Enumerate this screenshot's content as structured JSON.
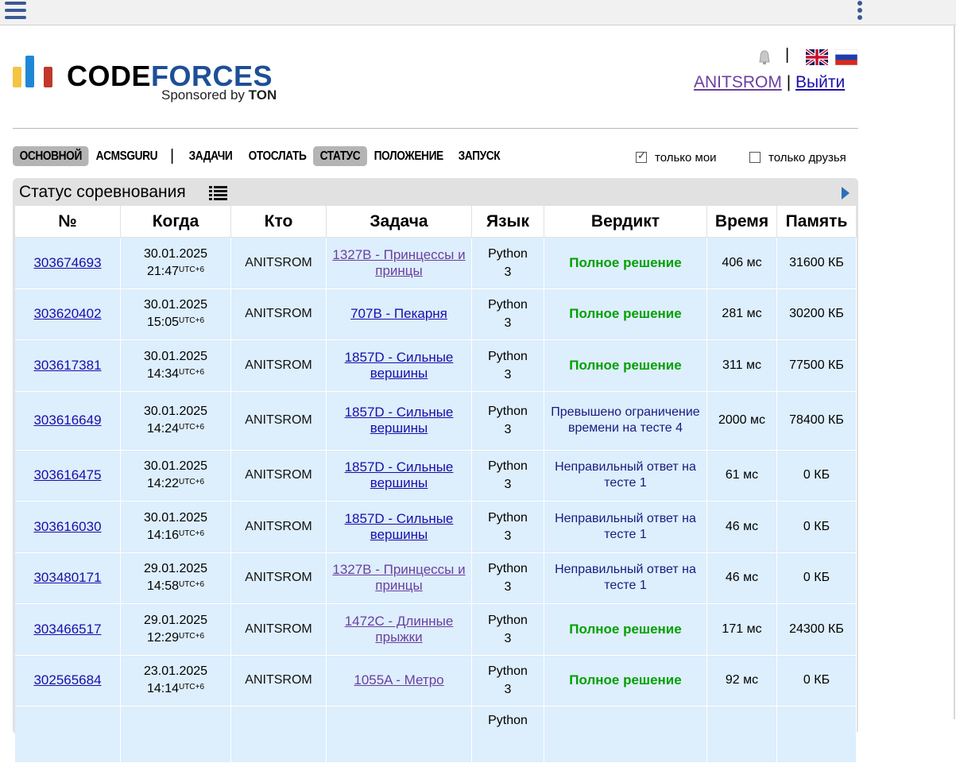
{
  "header": {
    "logo_code": "CODE",
    "logo_forces": "FORCES",
    "sponsor_prefix": "Sponsored by",
    "sponsor_brand": "TON",
    "separator": "|",
    "username": "ANITSROM",
    "user_separator": "|",
    "logout": "Выйти",
    "icons": [
      "menu-icon",
      "more-vert-icon",
      "bell-icon",
      "flag-uk-icon",
      "flag-ru-icon"
    ]
  },
  "menu": {
    "items": [
      {
        "label": "ОСНОВНОЙ",
        "active": true
      },
      {
        "label": "ACMSGURU",
        "active": false
      },
      {
        "label": "ЗАДАЧИ",
        "active": false
      },
      {
        "label": "ОТОСЛАТЬ",
        "active": false
      },
      {
        "label": "СТАТУС",
        "active": true
      },
      {
        "label": "ПОЛОЖЕНИЕ",
        "active": false
      },
      {
        "label": "ЗАПУСК",
        "active": false
      }
    ],
    "separator": "|",
    "filters": {
      "only_mine": {
        "label": "только мои",
        "checked": true
      },
      "only_friends": {
        "label": "только друзья",
        "checked": false
      }
    }
  },
  "status": {
    "title": "Статус соревнования",
    "columns": [
      "№",
      "Когда",
      "Кто",
      "Задача",
      "Язык",
      "Вердикт",
      "Время",
      "Память"
    ],
    "rows": [
      {
        "id": "303674693",
        "date": "30.01.2025",
        "time": "21:47",
        "tz": "UTC+6",
        "who": "ANITSROM",
        "problem": "1327B - Принцессы и принцы",
        "lang_1": "Python",
        "lang_2": "3",
        "verdict": "Полное решение",
        "ok": true,
        "run_time": "406 мс",
        "memory": "31600 КБ"
      },
      {
        "id": "303620402",
        "date": "30.01.2025",
        "time": "15:05",
        "tz": "UTC+6",
        "who": "ANITSROM",
        "problem": "707B - Пекарня",
        "lang_1": "Python",
        "lang_2": "3",
        "verdict": "Полное решение",
        "ok": true,
        "run_time": "281 мс",
        "memory": "30200 КБ"
      },
      {
        "id": "303617381",
        "date": "30.01.2025",
        "time": "14:34",
        "tz": "UTC+6",
        "who": "ANITSROM",
        "problem": "1857D - Сильные вершины",
        "lang_1": "Python",
        "lang_2": "3",
        "verdict": "Полное решение",
        "ok": true,
        "run_time": "311 мс",
        "memory": "77500 КБ"
      },
      {
        "id": "303616649",
        "date": "30.01.2025",
        "time": "14:24",
        "tz": "UTC+6",
        "who": "ANITSROM",
        "problem": "1857D - Сильные вершины",
        "lang_1": "Python",
        "lang_2": "3",
        "verdict": "Превышено ограничение времени на тесте 4",
        "ok": false,
        "run_time": "2000 мс",
        "memory": "78400 КБ"
      },
      {
        "id": "303616475",
        "date": "30.01.2025",
        "time": "14:22",
        "tz": "UTC+6",
        "who": "ANITSROM",
        "problem": "1857D - Сильные вершины",
        "lang_1": "Python",
        "lang_2": "3",
        "verdict": "Неправильный ответ на тесте 1",
        "ok": false,
        "run_time": "61 мс",
        "memory": "0 КБ"
      },
      {
        "id": "303616030",
        "date": "30.01.2025",
        "time": "14:16",
        "tz": "UTC+6",
        "who": "ANITSROM",
        "problem": "1857D - Сильные вершины",
        "lang_1": "Python",
        "lang_2": "3",
        "verdict": "Неправильный ответ на тесте 1",
        "ok": false,
        "run_time": "46 мс",
        "memory": "0 КБ"
      },
      {
        "id": "303480171",
        "date": "29.01.2025",
        "time": "14:58",
        "tz": "UTC+6",
        "who": "ANITSROM",
        "problem": "1327B - Принцессы и принцы",
        "lang_1": "Python",
        "lang_2": "3",
        "verdict": "Неправильный ответ на тесте 1",
        "ok": false,
        "run_time": "46 мс",
        "memory": "0 КБ"
      },
      {
        "id": "303466517",
        "date": "29.01.2025",
        "time": "12:29",
        "tz": "UTC+6",
        "who": "ANITSROM",
        "problem": "1472C - Длинные прыжки",
        "lang_1": "Python",
        "lang_2": "3",
        "verdict": "Полное решение",
        "ok": true,
        "run_time": "171 мс",
        "memory": "24300 КБ"
      },
      {
        "id": "302565684",
        "date": "23.01.2025",
        "time": "14:14",
        "tz": "UTC+6",
        "who": "ANITSROM",
        "problem": "1055A - Метро",
        "lang_1": "Python",
        "lang_2": "3",
        "verdict": "Полное решение",
        "ok": true,
        "run_time": "92 мс",
        "memory": "0 КБ"
      }
    ],
    "partial_row_lang": "Python"
  },
  "colors": {
    "row_bg": "#ddeefc",
    "accepted": "#00a000",
    "verdict_other": "#1a1a80",
    "link": "#1a0dab",
    "visited": "#6b3fa0",
    "logo_blue": "#1e4f96"
  }
}
